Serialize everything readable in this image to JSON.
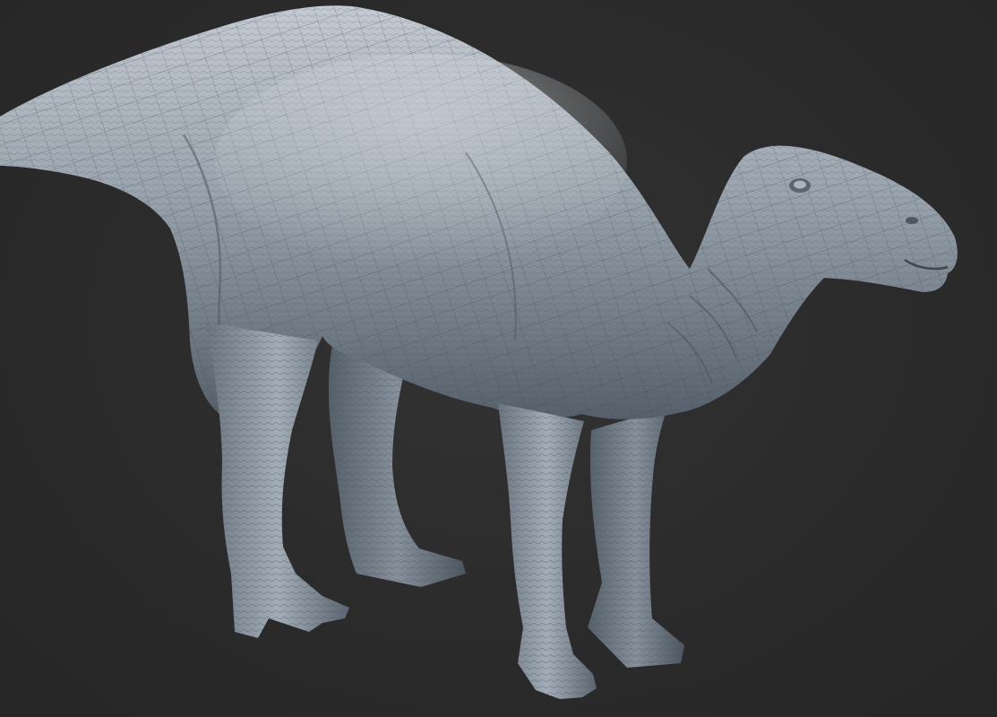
{
  "scene": {
    "subject_icon": "dinosaur-sculpt-icon",
    "colors": {
      "background": "#2b2b2b",
      "clay_light": "#c9cfd6",
      "clay_mid": "#8e98a3",
      "clay_dark": "#4a525c",
      "wire": "#3a424b"
    }
  }
}
